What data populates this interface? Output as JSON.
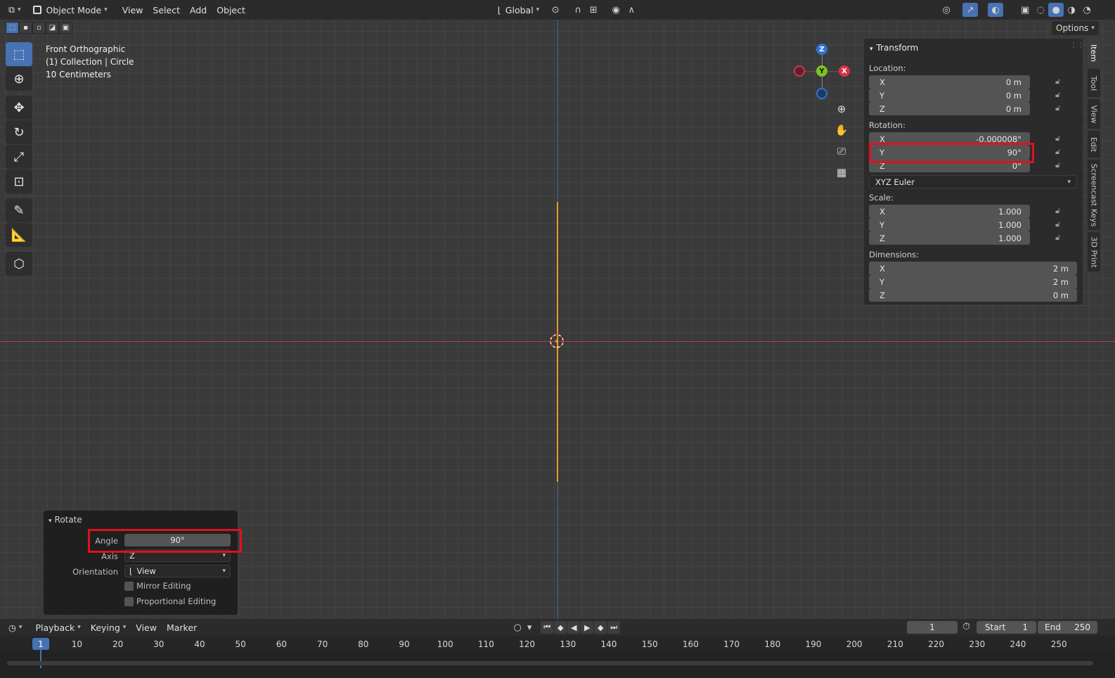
{
  "header": {
    "mode": "Object Mode",
    "menus": [
      "View",
      "Select",
      "Add",
      "Object"
    ],
    "orientation": "Global",
    "options_label": "Options"
  },
  "viewport": {
    "view_name": "Front Orthographic",
    "collection": "(1) Collection | Circle",
    "scale": "10 Centimeters",
    "gizmo": {
      "z": "Z",
      "y": "Y",
      "x": "X"
    }
  },
  "npanel": {
    "title": "Transform",
    "location_label": "Location:",
    "location": [
      {
        "axis": "X",
        "value": "0 m"
      },
      {
        "axis": "Y",
        "value": "0 m"
      },
      {
        "axis": "Z",
        "value": "0 m"
      }
    ],
    "rotation_label": "Rotation:",
    "rotation": [
      {
        "axis": "X",
        "value": "-0.000008°"
      },
      {
        "axis": "Y",
        "value": "90°"
      },
      {
        "axis": "Z",
        "value": "0°"
      }
    ],
    "rotation_mode": "XYZ Euler",
    "scale_label": "Scale:",
    "scale": [
      {
        "axis": "X",
        "value": "1.000"
      },
      {
        "axis": "Y",
        "value": "1.000"
      },
      {
        "axis": "Z",
        "value": "1.000"
      }
    ],
    "dimensions_label": "Dimensions:",
    "dimensions": [
      {
        "axis": "X",
        "value": "2 m"
      },
      {
        "axis": "Y",
        "value": "2 m"
      },
      {
        "axis": "Z",
        "value": "0 m"
      }
    ],
    "tabs": [
      "Item",
      "Tool",
      "View",
      "Edit",
      "Screencast Keys",
      "3D Print"
    ]
  },
  "operator": {
    "title": "Rotate",
    "angle_label": "Angle",
    "angle": "90°",
    "axis_label": "Axis",
    "axis": "Z",
    "orientation_label": "Orientation",
    "orientation": "View",
    "mirror": "Mirror Editing",
    "proportional": "Proportional Editing"
  },
  "timeline": {
    "menus": [
      "Playback",
      "Keying",
      "View",
      "Marker"
    ],
    "current_frame": "1",
    "start_label": "Start",
    "start": "1",
    "end_label": "End",
    "end": "250",
    "ticks": [
      "10",
      "20",
      "30",
      "40",
      "50",
      "60",
      "70",
      "80",
      "90",
      "100",
      "110",
      "120",
      "130",
      "140",
      "150",
      "160",
      "170",
      "180",
      "190",
      "200",
      "210",
      "220",
      "230",
      "240",
      "250"
    ],
    "cursor_frame": "1"
  }
}
